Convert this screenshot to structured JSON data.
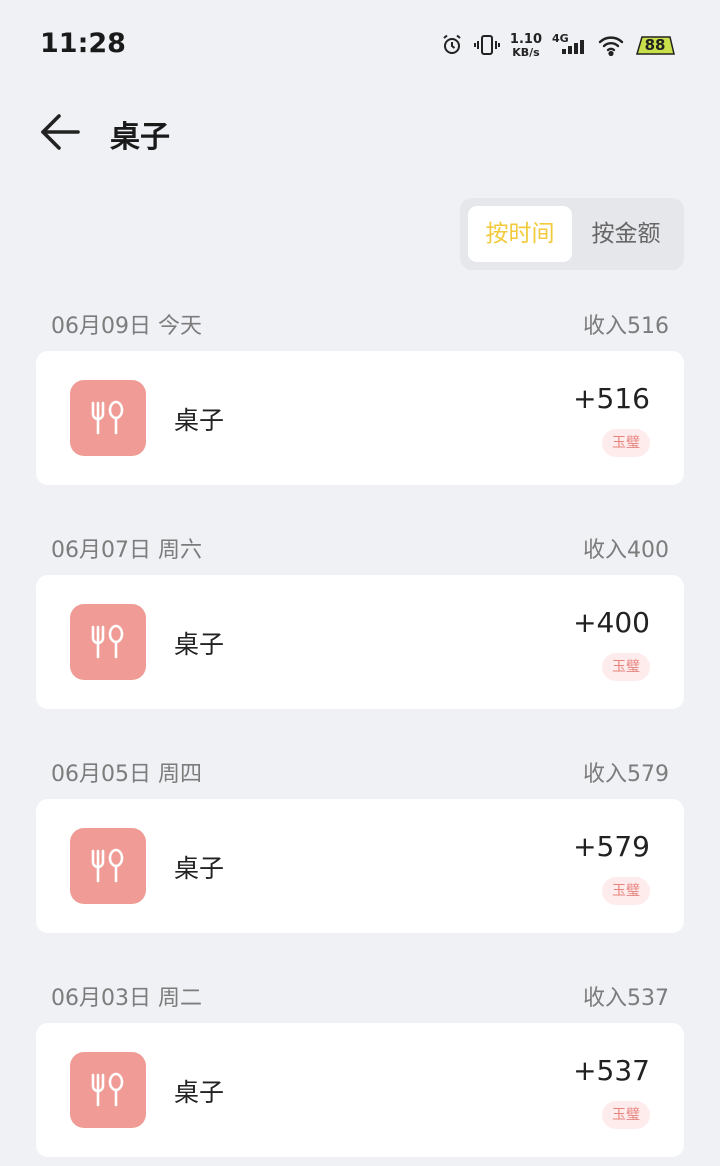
{
  "status_bar": {
    "time": "11:28",
    "net_speed_value": "1.10",
    "net_speed_unit": "KB/s",
    "network_type": "4G",
    "battery": "88",
    "icons": [
      "alarm-icon",
      "vibrate-icon",
      "signal-icon",
      "wifi-icon",
      "battery-icon"
    ]
  },
  "header": {
    "title": "桌子",
    "back_icon": "arrow-left-icon"
  },
  "sort": {
    "active_label": "按时间",
    "inactive_label": "按金额"
  },
  "colors": {
    "accent": "#f2ca3c",
    "category_icon_bg": "#f09b95",
    "tag_bg": "#fdeceb",
    "tag_text": "#e8837e",
    "page_bg": "#f0f1f5"
  },
  "groups": [
    {
      "date": "06月09日 今天",
      "total": "收入516",
      "item": {
        "icon": "utensils-icon",
        "name": "桌子",
        "amount": "+516",
        "tag": "玉璧"
      }
    },
    {
      "date": "06月07日 周六",
      "total": "收入400",
      "item": {
        "icon": "utensils-icon",
        "name": "桌子",
        "amount": "+400",
        "tag": "玉璧"
      }
    },
    {
      "date": "06月05日 周四",
      "total": "收入579",
      "item": {
        "icon": "utensils-icon",
        "name": "桌子",
        "amount": "+579",
        "tag": "玉璧"
      }
    },
    {
      "date": "06月03日 周二",
      "total": "收入537",
      "item": {
        "icon": "utensils-icon",
        "name": "桌子",
        "amount": "+537",
        "tag": "玉璧"
      }
    }
  ]
}
